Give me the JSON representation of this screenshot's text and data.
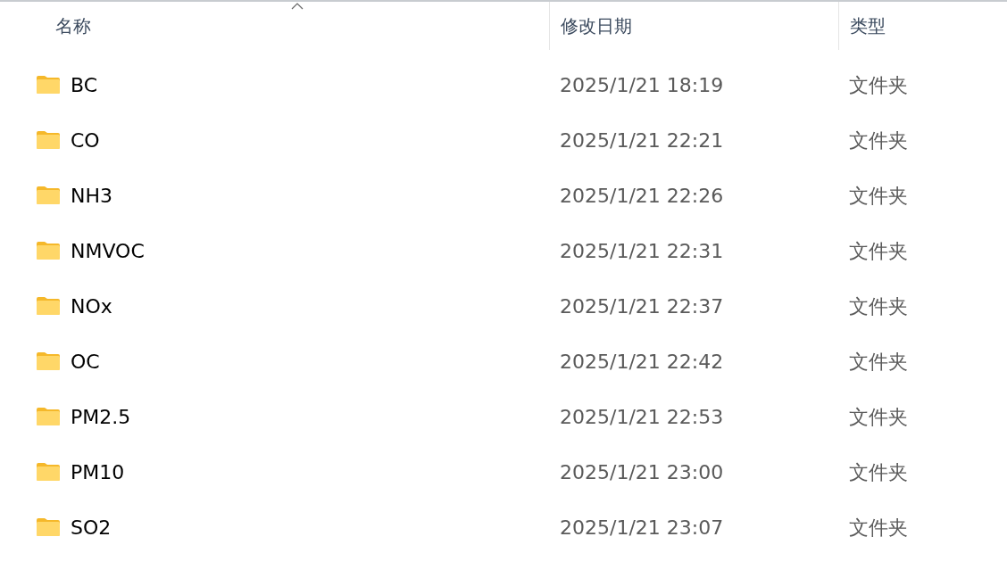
{
  "columns": [
    {
      "label": "名称",
      "sorted": true
    },
    {
      "label": "修改日期",
      "sorted": false
    },
    {
      "label": "类型",
      "sorted": false
    }
  ],
  "rows": [
    {
      "name": "BC",
      "date": "2025/1/21 18:19",
      "type": "文件夹"
    },
    {
      "name": "CO",
      "date": "2025/1/21 22:21",
      "type": "文件夹"
    },
    {
      "name": "NH3",
      "date": "2025/1/21 22:26",
      "type": "文件夹"
    },
    {
      "name": "NMVOC",
      "date": "2025/1/21 22:31",
      "type": "文件夹"
    },
    {
      "name": "NOx",
      "date": "2025/1/21 22:37",
      "type": "文件夹"
    },
    {
      "name": "OC",
      "date": "2025/1/21 22:42",
      "type": "文件夹"
    },
    {
      "name": "PM2.5",
      "date": "2025/1/21 22:53",
      "type": "文件夹"
    },
    {
      "name": "PM10",
      "date": "2025/1/21 23:00",
      "type": "文件夹"
    },
    {
      "name": "SO2",
      "date": "2025/1/21 23:07",
      "type": "文件夹"
    }
  ]
}
